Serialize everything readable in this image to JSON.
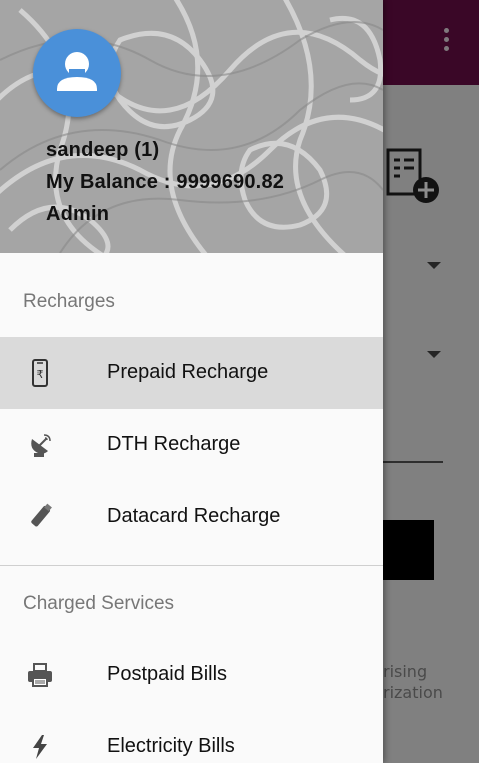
{
  "background": {
    "partial_text_1": "rising",
    "partial_text_2": "rization"
  },
  "drawer": {
    "header": {
      "username": "sandeep (1)",
      "balance": "My Balance : 9999690.82",
      "role": "Admin"
    },
    "sections": [
      {
        "title": "Recharges",
        "items": [
          {
            "label": "Prepaid Recharge",
            "icon": "mobile-rupee-icon",
            "selected": true
          },
          {
            "label": "DTH Recharge",
            "icon": "satellite-dish-icon",
            "selected": false
          },
          {
            "label": "Datacard Recharge",
            "icon": "usb-datacard-icon",
            "selected": false
          }
        ]
      },
      {
        "title": "Charged Services",
        "items": [
          {
            "label": "Postpaid Bills",
            "icon": "printer-icon",
            "selected": false
          },
          {
            "label": "Electricity Bills",
            "icon": "lightning-icon",
            "selected": false
          }
        ]
      }
    ]
  },
  "colors": {
    "appbar": "#6a0d47",
    "avatar": "#4a90d9",
    "selected_row": "#dadada"
  }
}
